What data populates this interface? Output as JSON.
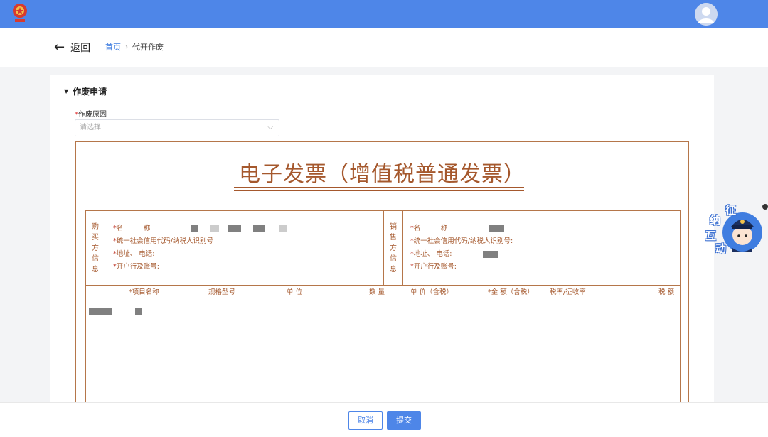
{
  "header": {
    "logo_icon": "tax-emblem-icon",
    "avatar_icon": "user-avatar-icon",
    "brand_color": "#4e86e8"
  },
  "subheader": {
    "back_label": "返回",
    "breadcrumb": {
      "home": "首页",
      "current": "代开作废"
    }
  },
  "form": {
    "section_title": "作废申请",
    "reason_label": "作废原因",
    "reason_placeholder": "请选择"
  },
  "invoice": {
    "title": "电子发票（增值税普通发票）",
    "buyer_label": [
      "购",
      "买",
      "方",
      "信",
      "息"
    ],
    "seller_label": [
      "销",
      "售",
      "方",
      "信",
      "息"
    ],
    "buyer_fields": {
      "name": "名　　　称",
      "credit_code": "统一社会信用代码/纳税人识别号",
      "address_phone": "地址、 电话",
      "bank_account": "开户行及账号"
    },
    "seller_fields": {
      "name": "名　　　称",
      "credit_code": "统一社会信用代码/纳税人识别号",
      "address_phone": "地址、 电话",
      "bank_account": "开户行及账号"
    },
    "item_headers": {
      "name": "*项目名称",
      "spec": "规格型号",
      "unit": "单 位",
      "qty": "数 量",
      "price": "单 价（含税）",
      "amount": "*金 额（含税）",
      "rate": "税率/征收率",
      "tax": "税 额"
    },
    "accent_color": "#a5582d"
  },
  "footer": {
    "cancel_label": "取消",
    "submit_label": "提交"
  },
  "mascot": {
    "chars": [
      "征",
      "纳",
      "互",
      "动"
    ],
    "icon": "tax-officer-mascot-icon"
  }
}
